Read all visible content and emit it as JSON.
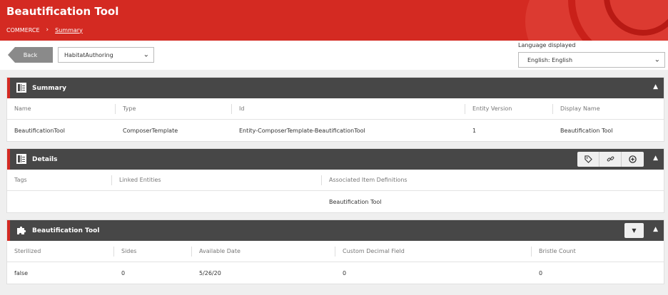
{
  "header": {
    "title": "Beautification Tool",
    "breadcrumb": {
      "root": "COMMERCE",
      "separator": "›",
      "current": "Summary"
    }
  },
  "toolbar": {
    "back_label": "Back",
    "environment_select": "HabitatAuthoring",
    "language_label": "Language displayed",
    "language_select": "English: English"
  },
  "summary": {
    "title": "Summary",
    "columns": [
      "Name",
      "Type",
      "Id",
      "Entity Version",
      "Display Name"
    ],
    "rows": [
      [
        "BeautificationTool",
        "ComposerTemplate",
        "Entity-ComposerTemplate-BeautificationTool",
        "1",
        "Beautification Tool"
      ]
    ]
  },
  "details": {
    "title": "Details",
    "columns": [
      "Tags",
      "Linked Entities",
      "Associated Item Definitions"
    ],
    "rows": [
      [
        "",
        "",
        "Beautification Tool"
      ]
    ]
  },
  "tool": {
    "title": "Beautification Tool",
    "columns": [
      "Sterilized",
      "Sides",
      "Available Date",
      "Custom Decimal Field",
      "Bristle Count"
    ],
    "rows": [
      [
        "false",
        "0",
        "5/26/20",
        "0",
        "0"
      ]
    ]
  },
  "icons": {
    "summary": "table-icon",
    "details": "table-icon",
    "tool": "puzzle-icon",
    "tag": "tag-icon",
    "link": "link-icon",
    "add": "plus-circle-icon",
    "collapse": "chevron-up-icon",
    "dropdown": "triangle-down-icon"
  },
  "colors": {
    "brand": "#d42a22",
    "panel_header": "#474747",
    "back_button": "#8a8a8a"
  }
}
